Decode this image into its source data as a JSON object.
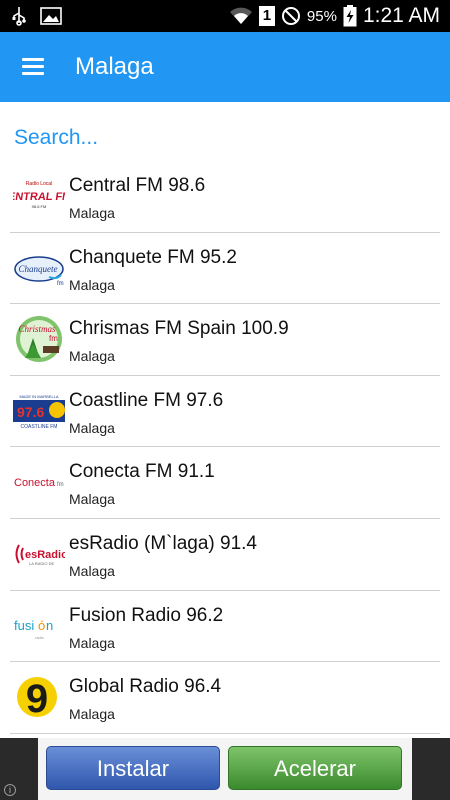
{
  "status_bar": {
    "battery": "95%",
    "time": "1:21 AM",
    "sim_label": "1",
    "icons": [
      "usb-icon",
      "image-icon",
      "wifi-icon",
      "sim-icon",
      "do-not-disturb-icon",
      "battery-charging-icon"
    ]
  },
  "app_bar": {
    "title": "Malaga",
    "menu_icon": "hamburger-menu-icon",
    "color": "#2196f3"
  },
  "search": {
    "placeholder": "Search..."
  },
  "stations": [
    {
      "name": "Central FM 98.6",
      "city": "Malaga",
      "logo": "central-fm-logo"
    },
    {
      "name": "Chanquete FM 95.2",
      "city": "Malaga",
      "logo": "chanquete-fm-logo"
    },
    {
      "name": "Chrismas FM Spain 100.9",
      "city": "Malaga",
      "logo": "christmas-fm-logo"
    },
    {
      "name": "Coastline FM 97.6",
      "city": "Malaga",
      "logo": "coastline-fm-logo"
    },
    {
      "name": "Conecta FM 91.1",
      "city": "Malaga",
      "logo": "conecta-fm-logo"
    },
    {
      "name": "esRadio (M`laga) 91.4",
      "city": "Malaga",
      "logo": "esradio-logo"
    },
    {
      "name": "Fusion Radio 96.2",
      "city": "Malaga",
      "logo": "fusion-radio-logo"
    },
    {
      "name": "Global Radio 96.4",
      "city": "Malaga",
      "logo": "global-radio-logo"
    }
  ],
  "ad": {
    "install_label": "Instalar",
    "speed_label": "Acelerar",
    "info_label": "i"
  }
}
